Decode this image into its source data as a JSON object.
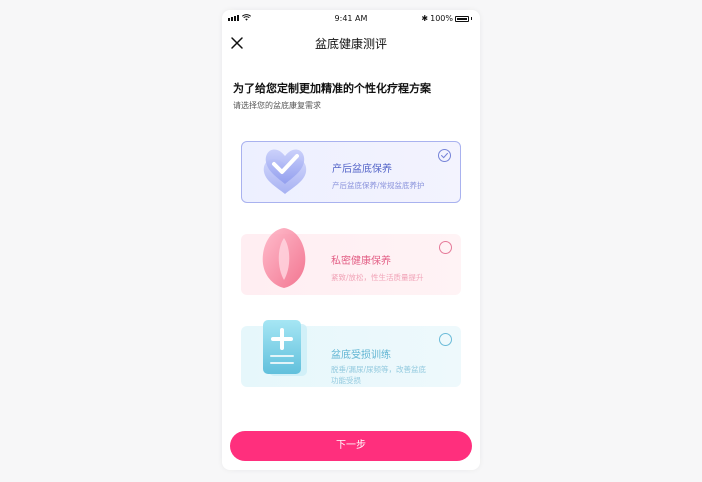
{
  "status_bar": {
    "time": "9:41 AM",
    "battery": "100%"
  },
  "nav": {
    "title": "盆底健康测评",
    "close_icon": "close-icon"
  },
  "heading": "为了给您定制更加精准的个性化疗程方案",
  "subheading": "请选择您的盆底康复需求",
  "options": [
    {
      "title": "产后盆底保养",
      "desc_line1": "产后盆底保养/常规盆底养护",
      "desc_line2": "",
      "selected": true,
      "accent": "#5465c8",
      "icon": "heart-check-icon"
    },
    {
      "title": "私密健康保养",
      "desc_line1": "紧致/放松，性生活质量提升",
      "desc_line2": "",
      "selected": false,
      "accent": "#e35f86",
      "icon": "intimate-care-icon"
    },
    {
      "title": "盆底受损训练",
      "desc_line1": "脱垂/漏尿/尿频等，改善盆底",
      "desc_line2": "功能受损",
      "selected": false,
      "accent": "#61b5d3",
      "icon": "medical-kit-icon"
    }
  ],
  "next_button": {
    "label": "下一步",
    "color": "#ff2f7d"
  }
}
